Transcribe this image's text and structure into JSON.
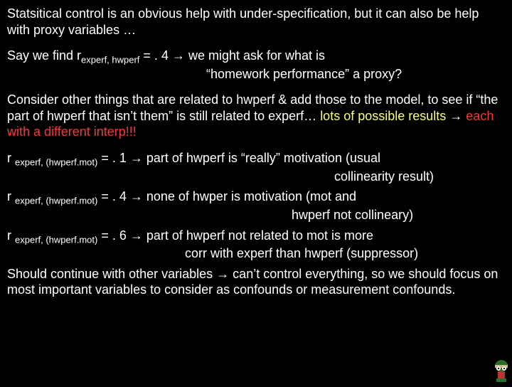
{
  "p1": "Statsitical control is an obvious help with under-specification, but it can also be help with proxy variables …",
  "p2a": "Say we find   r",
  "p2sub": "experf, hwperf",
  "p2b": " = . 4  →  we might ask for what is",
  "p2c": "“homework performance” a proxy?",
  "p3a": "Consider other things that are related to hwperf & add those to the model, to see if “the part of hwperf that isn’t them” is still related to experf… ",
  "p3b": "lots of possible results",
  "p3c": " → ",
  "p3d": "each with a different interp!!!",
  "r_prefix": "r ",
  "r_sub": "experf, (hwperf.mot)",
  "r1a": " = . 1  →   part of hwperf is “really” motivation (usual",
  "r1b": "collinearity result)",
  "r2a": " = . 4  →   none of hwper is motivation (mot and",
  "r2b": "hwperf not collineary)",
  "r3a": " = . 6  →   part of hwperf not related to mot is more",
  "r3b": "corr with experf than hwperf (suppressor)",
  "p4": "Should continue with other variables → can’t control everything, so we should focus on most important variables to consider as confounds or measurement confounds."
}
